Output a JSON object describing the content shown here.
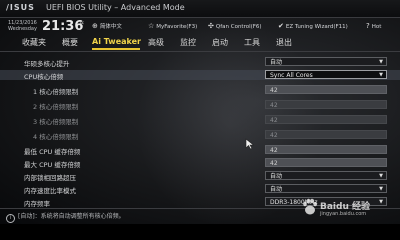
{
  "header": {
    "logo": "/ISUS",
    "title": "UEFI BIOS Utility – Advanced Mode"
  },
  "infobar": {
    "date": "11/23/2016",
    "weekday": "Wednesday",
    "time": "21:36",
    "items": [
      {
        "icon": "globe-icon",
        "glyph": "⊕",
        "label": "简体中文"
      },
      {
        "icon": "star-icon",
        "glyph": "☆",
        "label": "MyFavorite(F3)"
      },
      {
        "icon": "fan-icon",
        "glyph": "✣",
        "label": "Qfan Control(F6)"
      },
      {
        "icon": "wizard-icon",
        "glyph": "✔",
        "label": "EZ Tuning Wizard(F11)"
      },
      {
        "icon": "hotkey-icon",
        "glyph": "?",
        "label": "Hot"
      }
    ]
  },
  "tabs": [
    {
      "label": "收藏夹",
      "active": false
    },
    {
      "label": "概要",
      "active": false
    },
    {
      "label": "Ai Tweaker",
      "active": true
    },
    {
      "label": "高级",
      "active": false
    },
    {
      "label": "监控",
      "active": false
    },
    {
      "label": "启动",
      "active": false
    },
    {
      "label": "工具",
      "active": false
    },
    {
      "label": "退出",
      "active": false
    }
  ],
  "settings": [
    {
      "label": "华硕多核心提升",
      "value": "自动",
      "kind": "dropdown"
    },
    {
      "label": "CPU核心倍频",
      "value": "Sync All Cores",
      "kind": "dropdown",
      "selected": true
    },
    {
      "label": "1 核心倍频限制",
      "value": "42",
      "kind": "input",
      "sub": true,
      "bright": true
    },
    {
      "label": "2 核心倍频限制",
      "value": "42",
      "kind": "input",
      "sub": true,
      "dim": true
    },
    {
      "label": "3 核心倍频限制",
      "value": "42",
      "kind": "input",
      "sub": true,
      "dim": true
    },
    {
      "label": "4 核心倍频限制",
      "value": "42",
      "kind": "input",
      "sub": true,
      "dim": true
    },
    {
      "label": "最低 CPU 缓存倍频",
      "value": "42",
      "kind": "input"
    },
    {
      "label": "最大 CPU 缓存倍频",
      "value": "42",
      "kind": "input"
    },
    {
      "label": "内部锁相回路超压",
      "value": "自动",
      "kind": "dropdown"
    },
    {
      "label": "内存速度比率模式",
      "value": "自动",
      "kind": "dropdown"
    },
    {
      "label": "内存频率",
      "value": "DDR3-1800MHz",
      "kind": "dropdown"
    }
  ],
  "help": {
    "text": "[自动]：系统将自动调整所有核心倍频。"
  },
  "watermark": {
    "name": "Baidu 经验",
    "url": "jingyan.baidu.com"
  },
  "colors": {
    "accent": "#e9c531",
    "background": "#151618"
  }
}
